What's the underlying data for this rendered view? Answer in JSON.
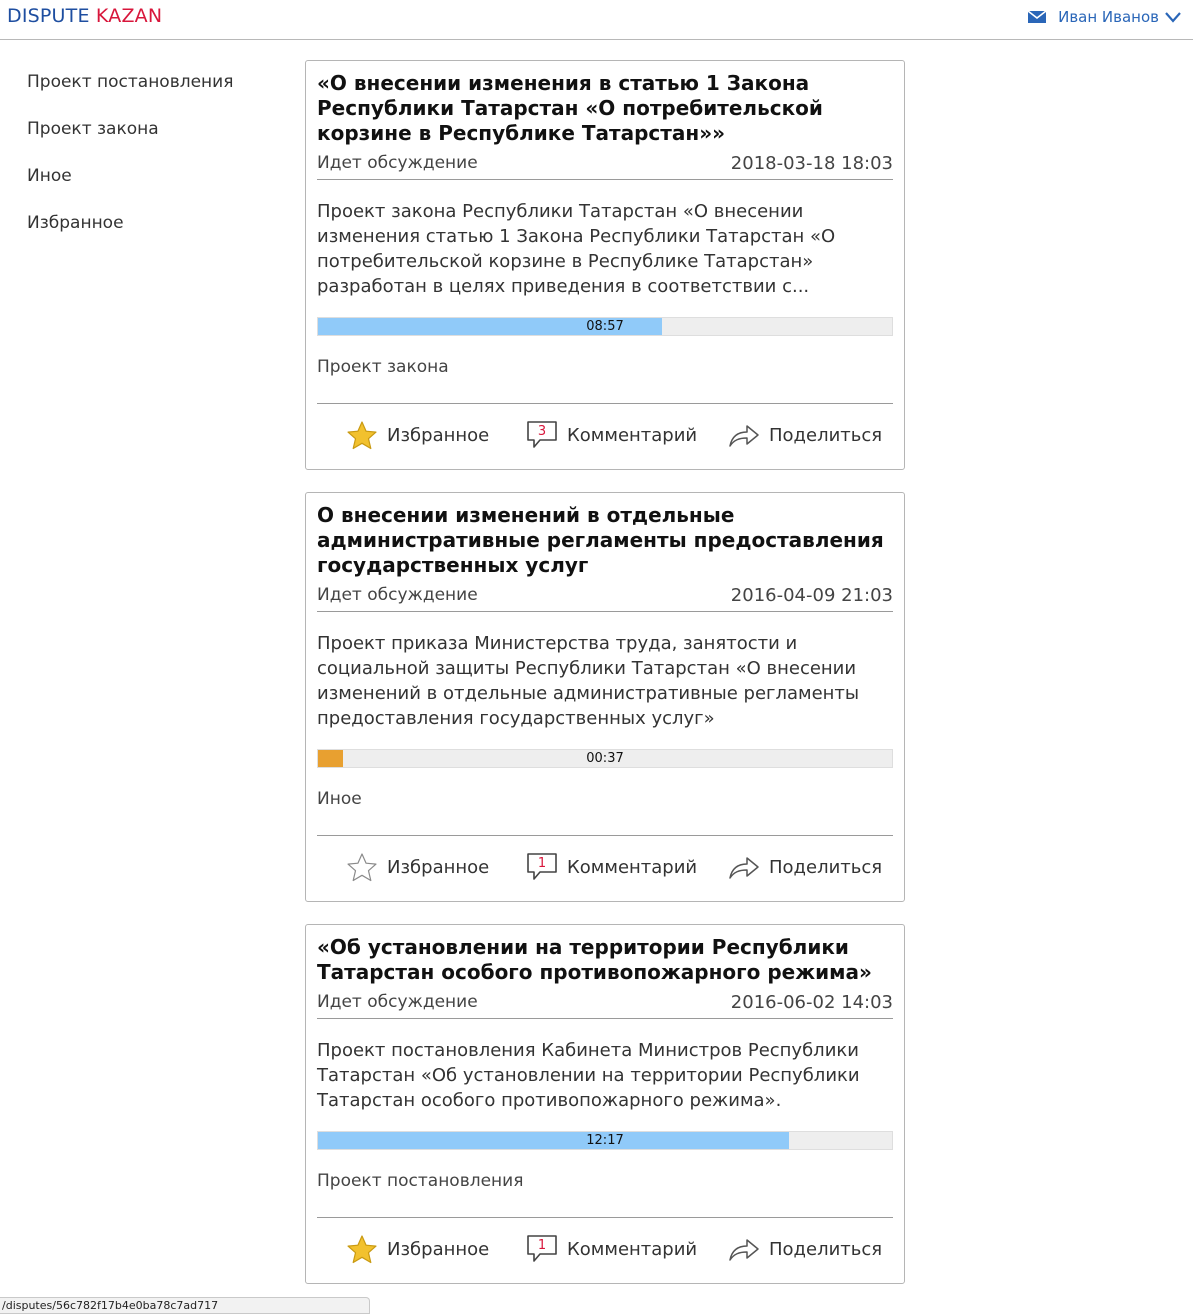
{
  "header": {
    "logo_part1": "DISPUTE",
    "logo_part2": "KAZAN",
    "user_name": "Иван Иванов"
  },
  "sidebar": {
    "items": [
      {
        "label": "Проект постановления"
      },
      {
        "label": "Проект закона"
      },
      {
        "label": "Иное"
      },
      {
        "label": "Избранное"
      }
    ]
  },
  "cards": [
    {
      "title": "«О внесении изменения в статью 1 Закона Республики Татарстан «О потребительской корзине в Республике Татарстан»»",
      "status": "Идет обсуждение",
      "date": "2018-03-18 18:03",
      "description": "Проект закона Республики Татарстан «О внесении изменения статью 1 Закона Республики Татарстан «О потребительской корзине в Республике Татарстан» разработан в целях приведения в соответствии с...",
      "timer": "08:57",
      "progress_fraction": 0.6,
      "progress_color": "#90caf9",
      "category": "Проект закона",
      "favorite_label": "Избранное",
      "favorited": true,
      "comment_label": "Комментарий",
      "comment_count": "3",
      "share_label": "Поделиться"
    },
    {
      "title": "О внесении изменений в отдельные административные регламенты предоставления государственных услуг",
      "status": "Идет обсуждение",
      "date": "2016-04-09 21:03",
      "description": "Проект приказа Министерства труда, занятости и социальной защиты Республики Татарстан «О внесении изменений в отдельные административные регламенты предоставления государственных услуг»",
      "timer": "00:37",
      "progress_fraction": 0.043,
      "progress_color": "#e8a030",
      "category": "Иное",
      "favorite_label": "Избранное",
      "favorited": false,
      "comment_label": "Комментарий",
      "comment_count": "1",
      "share_label": "Поделиться"
    },
    {
      "title": "«Об установлении на территории Республики Татарстан особого противопожарного режима»",
      "status": "Идет обсуждение",
      "date": "2016-06-02 14:03",
      "description": "Проект постановления Кабинета Министров Республики Татарстан «Об установлении на территории Республики Татарстан особого противопожарного режима».",
      "timer": "12:17",
      "progress_fraction": 0.82,
      "progress_color": "#90caf9",
      "category": "Проект постановления",
      "favorite_label": "Избранное",
      "favorited": true,
      "comment_label": "Комментарий",
      "comment_count": "1",
      "share_label": "Поделиться"
    }
  ],
  "statusbar": {
    "url": "/disputes/56c782f17b4e0ba78c7ad717"
  },
  "colors": {
    "logo_blue": "#1e4ea0",
    "logo_red": "#d8163b",
    "user_blue": "#2a66b8",
    "star_gold": "#f2c12e"
  },
  "icons": [
    "mail-icon",
    "chevron-down-icon",
    "star-icon",
    "comment-icon",
    "share-icon"
  ]
}
